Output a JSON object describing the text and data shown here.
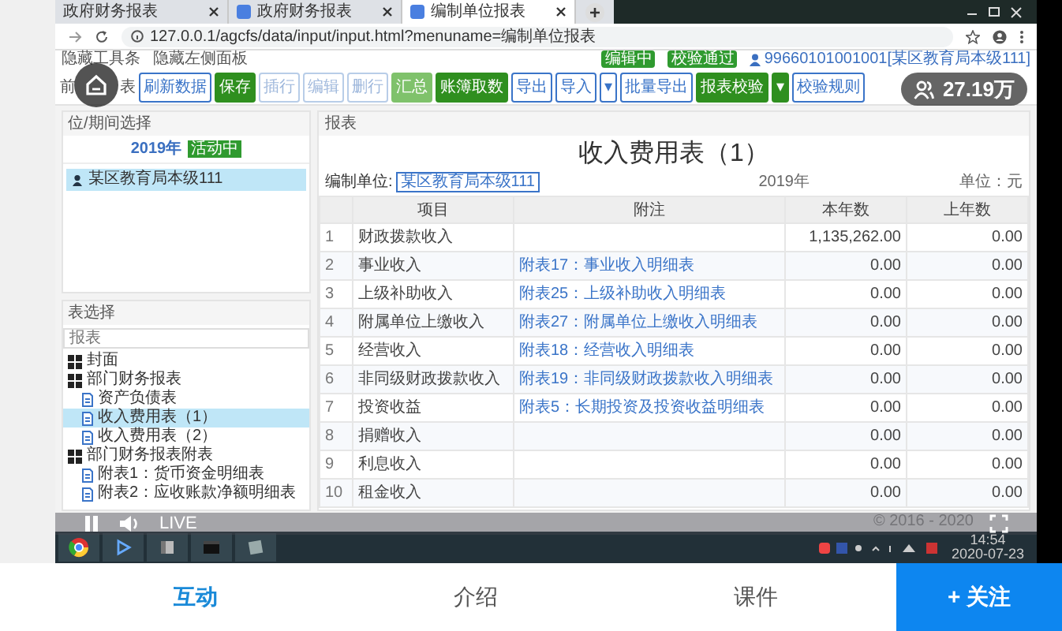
{
  "app": {
    "viewer_count": "27.19万",
    "live_label": "LIVE",
    "tabs": [
      {
        "label": "互动",
        "selected": true
      },
      {
        "label": "介绍",
        "selected": false
      },
      {
        "label": "课件",
        "selected": false
      }
    ],
    "follow_button": "+ 关注"
  },
  "screen": {
    "browser_tabs": [
      {
        "label": "政府财务报表",
        "selected": false,
        "favicon": false
      },
      {
        "label": "政府财务报表",
        "selected": false,
        "favicon": true
      },
      {
        "label": "编制单位报表",
        "selected": true,
        "favicon": true
      }
    ],
    "address": "127.0.0.1/agcfs/data/input/input.html?menuname=编制单位报表",
    "bookmarks": [
      "隐藏工具条",
      "隐藏左侧面板"
    ],
    "status_badges": [
      "编辑中",
      "校验通过"
    ],
    "user": "99660101001001[某区教育局本级111]",
    "toolbar": {
      "title_parts": [
        "前",
        "表"
      ],
      "buttons": [
        {
          "label": "刷新数据",
          "kind": "outline"
        },
        {
          "label": "保存",
          "kind": "green"
        },
        {
          "label": "插行",
          "kind": "disabled"
        },
        {
          "label": "编辑",
          "kind": "disabled"
        },
        {
          "label": "删行",
          "kind": "disabled"
        },
        {
          "label": "汇总",
          "kind": "lightgreen"
        },
        {
          "label": "账簿取数",
          "kind": "green"
        },
        {
          "label": "导出",
          "kind": "outline"
        },
        {
          "label": "导入",
          "kind": "outline"
        },
        {
          "label": "▾",
          "kind": "outline"
        },
        {
          "label": "批量导出",
          "kind": "outline"
        },
        {
          "label": "报表校验",
          "kind": "green"
        },
        {
          "label": "▾",
          "kind": "green"
        },
        {
          "label": "校验规则",
          "kind": "outline"
        }
      ]
    },
    "unit_panel": {
      "title": "位/期间选择",
      "year": "2019年",
      "status_badge": "活动中",
      "units": [
        {
          "label": "某区教育局本级111",
          "selected": true
        }
      ]
    },
    "table_panel": {
      "title": "表选择",
      "search_placeholder": "报表",
      "tree": [
        {
          "label": "封面",
          "selected": false
        },
        {
          "label": "部门财务报表",
          "selected": false,
          "children": [
            {
              "label": "资产负债表",
              "selected": false
            },
            {
              "label": "收入费用表（1）",
              "selected": true
            },
            {
              "label": "收入费用表（2）",
              "selected": false
            }
          ]
        },
        {
          "label": "部门财务报表附表",
          "selected": false,
          "children": [
            {
              "label": "附表1：货币资金明细表",
              "selected": false
            },
            {
              "label": "附表2：应收账款净额明细表",
              "selected": false
            }
          ]
        }
      ]
    },
    "report": {
      "panel_title": "报表",
      "title": "收入费用表（1）",
      "unit_label": "编制单位:",
      "unit_value": "某区教育局本级111",
      "year": "2019年",
      "currency_unit": "单位：元",
      "columns": [
        "项目",
        "附注",
        "本年数",
        "上年数"
      ],
      "rows": [
        {
          "no": "1",
          "item": "财政拨款收入",
          "current": "1,135,262.00",
          "previous": "0.00"
        },
        {
          "no": "2",
          "item": "事业收入",
          "note": "附表17：事业收入明细表",
          "current": "0.00",
          "previous": "0.00"
        },
        {
          "no": "3",
          "item": "上级补助收入",
          "note": "附表25：上级补助收入明细表",
          "current": "0.00",
          "previous": "0.00"
        },
        {
          "no": "4",
          "item": "附属单位上缴收入",
          "note": "附表27：附属单位上缴收入明细表",
          "current": "0.00",
          "previous": "0.00"
        },
        {
          "no": "5",
          "item": "经营收入",
          "note": "附表18：经营收入明细表",
          "current": "0.00",
          "previous": "0.00"
        },
        {
          "no": "6",
          "item": "非同级财政拨款收入",
          "note": "附表19：非同级财政拨款收入明细表",
          "current": "0.00",
          "previous": "0.00"
        },
        {
          "no": "7",
          "item": "投资收益",
          "note": "附表5：长期投资及投资收益明细表",
          "current": "0.00",
          "previous": "0.00"
        },
        {
          "no": "8",
          "item": "捐赠收入",
          "current": "0.00",
          "previous": "0.00"
        },
        {
          "no": "9",
          "item": "利息收入",
          "current": "0.00",
          "previous": "0.00"
        },
        {
          "no": "10",
          "item": "租金收入",
          "current": "0.00",
          "previous": "0.00"
        }
      ]
    },
    "footer": "© 2016 - 2020",
    "taskbar": {
      "time": "14:54",
      "date": "2020-07-23"
    }
  }
}
